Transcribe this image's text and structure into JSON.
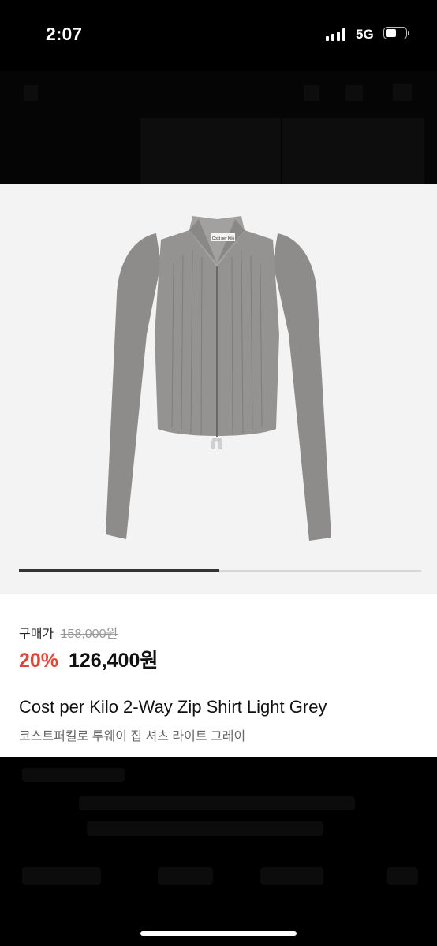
{
  "status_bar": {
    "time": "2:07",
    "network": "5G",
    "battery_level": 0.45
  },
  "product": {
    "purchase_label": "구매가",
    "original_price": "158,000원",
    "discount": "20%",
    "sale_price": "126,400원",
    "title_en": "Cost per Kilo 2-Way Zip Shirt Light Grey",
    "title_ko": "코스트퍼킬로 투웨이 집 셔츠 라이트 그레이",
    "brand_label": "Cost per Kilo",
    "image_color": "#8e8b8b"
  },
  "gallery": {
    "position": 1,
    "total": 2
  },
  "colors": {
    "discount": "#e0463b",
    "overlay": "#000000"
  }
}
